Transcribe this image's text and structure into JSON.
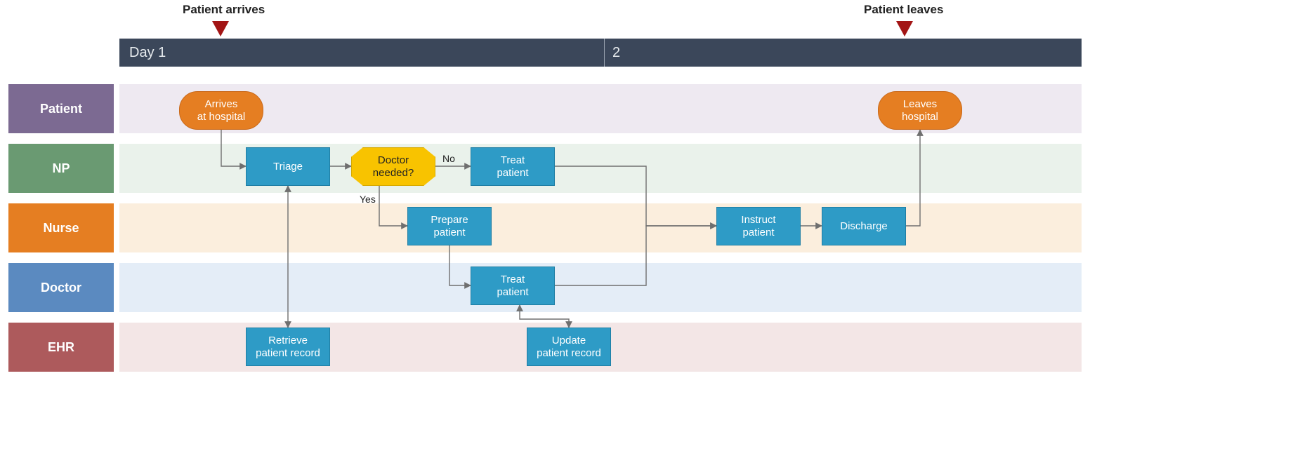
{
  "milestones": {
    "start": "Patient arrives",
    "end": "Patient leaves"
  },
  "timeline": {
    "day_prefix": "Day",
    "segments": [
      "1",
      "2"
    ]
  },
  "lanes": [
    {
      "id": "patient",
      "label": "Patient",
      "color": "#7c6a92",
      "strip": "#eee9f1"
    },
    {
      "id": "np",
      "label": "NP",
      "color": "#6a9a72",
      "strip": "#eaf2eb"
    },
    {
      "id": "nurse",
      "label": "Nurse",
      "color": "#e57e22",
      "strip": "#fbeedd"
    },
    {
      "id": "doctor",
      "label": "Doctor",
      "color": "#5b8ac0",
      "strip": "#e4edf7"
    },
    {
      "id": "ehr",
      "label": "EHR",
      "color": "#ad5a5c",
      "strip": "#f3e6e6"
    }
  ],
  "nodes": {
    "arrives": "Arrives\nat hospital",
    "triage": "Triage",
    "decision": "Doctor\nneeded?",
    "treat_np": "Treat\npatient",
    "prepare": "Prepare\npatient",
    "treat_doc": "Treat\npatient",
    "retrieve": "Retrieve\npatient record",
    "update": "Update\npatient record",
    "instruct": "Instruct\npatient",
    "discharge": "Discharge",
    "leaves": "Leaves\nhospital"
  },
  "edge_labels": {
    "no": "No",
    "yes": "Yes"
  }
}
